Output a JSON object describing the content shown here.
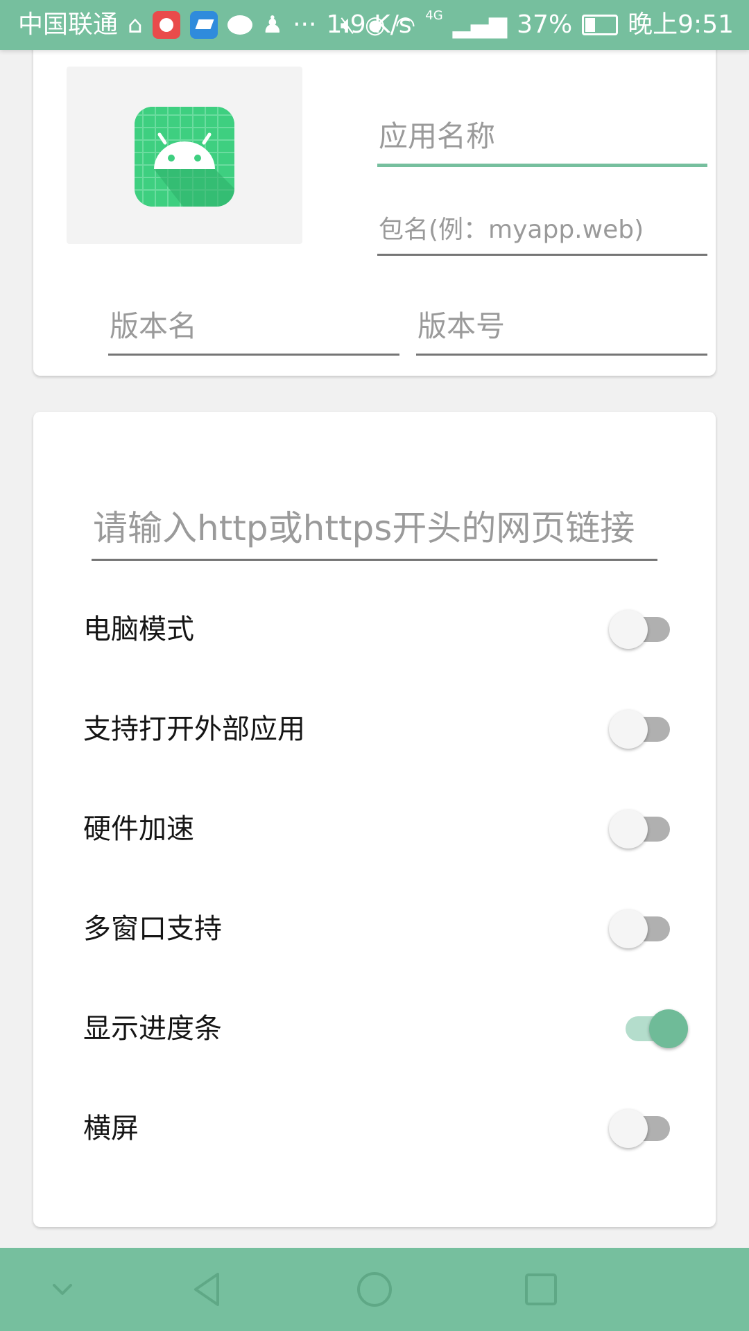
{
  "status_bar": {
    "carrier": "中国联通",
    "net_speed": "1.9 K/s",
    "network_type": "4G",
    "battery": "37%",
    "time": "晚上9:51",
    "more": "···",
    "background_color": "#76bf9e"
  },
  "app_info": {
    "icon_name": "android-app-icon",
    "app_name_placeholder": "应用名称",
    "package_placeholder": "包名(例：myapp.web)",
    "version_name_placeholder": "版本名",
    "version_code_placeholder": "版本号"
  },
  "web_settings": {
    "url_placeholder": "请输入http或https开头的网页链接",
    "options": [
      {
        "label": "电脑模式",
        "enabled": false
      },
      {
        "label": "支持打开外部应用",
        "enabled": false
      },
      {
        "label": "硬件加速",
        "enabled": false
      },
      {
        "label": "多窗口支持",
        "enabled": false
      },
      {
        "label": "显示进度条",
        "enabled": true
      },
      {
        "label": "横屏",
        "enabled": false
      }
    ]
  },
  "nav_bar": {
    "buttons": [
      "collapse-icon",
      "back-icon",
      "home-icon",
      "recents-icon"
    ]
  },
  "colors": {
    "accent": "#76bf9e",
    "switch_on_thumb": "#6fbb98",
    "switch_off_track": "#b0b0b0"
  }
}
